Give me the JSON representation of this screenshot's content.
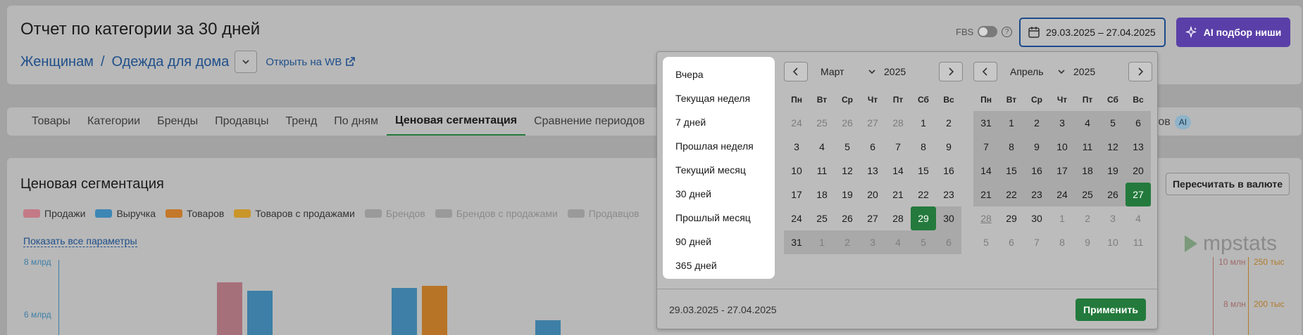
{
  "header": {
    "title": "Отчет по категории за 30 дней",
    "breadcrumb": [
      "Женщинам",
      "Одежда для дома"
    ],
    "open_wb": "Открыть на WB",
    "fbs_label": "FBS",
    "date_range": "29.03.2025 – 27.04.2025",
    "ai_button": "AI подбор ниши"
  },
  "tabs": [
    "Товары",
    "Категории",
    "Бренды",
    "Продавцы",
    "Тренд",
    "По дням",
    "Ценовая сегментация",
    "Сравнение периодов"
  ],
  "active_tab": "Ценовая сегментация",
  "tab_tail": "ктов",
  "tab_tail_badge": "AI",
  "section": {
    "title": "Ценовая сегментация",
    "recalc_button": "Пересчитать в валюте",
    "show_all": "Показать все параметры",
    "legend": [
      {
        "label": "Продажи",
        "color": "#c47a86",
        "active": true
      },
      {
        "label": "Выручка",
        "color": "#3d87b5",
        "active": true
      },
      {
        "label": "Товаров",
        "color": "#c4782a",
        "active": true
      },
      {
        "label": "Товаров с продажами",
        "color": "#c9962a",
        "active": true
      },
      {
        "label": "Брендов",
        "color": "#9a9a9a",
        "active": false
      },
      {
        "label": "Брендов с продажами",
        "color": "#9a9a9a",
        "active": false
      },
      {
        "label": "Продавцов",
        "color": "#9a9a9a",
        "active": false
      }
    ],
    "y_ticks": [
      "8 млрд",
      "6 млрд"
    ],
    "right_ticks_1": [
      "10 млн",
      "8 млн"
    ],
    "right_ticks_2": [
      "250 тыс",
      "200 тыс"
    ],
    "brand": "mpstats"
  },
  "picker": {
    "presets": [
      "Вчера",
      "Текущая неделя",
      "7 дней",
      "Прошлая неделя",
      "Текущий месяц",
      "30 дней",
      "Прошлый месяц",
      "90 дней",
      "365 дней"
    ],
    "weekdays": [
      "Пн",
      "Вт",
      "Ср",
      "Чт",
      "Пт",
      "Сб",
      "Вс"
    ],
    "left_month": "Март",
    "left_year": "2025",
    "right_month": "Апрель",
    "right_year": "2025",
    "left_days": [
      [
        "24",
        "25",
        "26",
        "27",
        "28",
        "1",
        "2"
      ],
      [
        "3",
        "4",
        "5",
        "6",
        "7",
        "8",
        "9"
      ],
      [
        "10",
        "11",
        "12",
        "13",
        "14",
        "15",
        "16"
      ],
      [
        "17",
        "18",
        "19",
        "20",
        "21",
        "22",
        "23"
      ],
      [
        "24",
        "25",
        "26",
        "27",
        "28",
        "29",
        "30"
      ],
      [
        "31",
        "1",
        "2",
        "3",
        "4",
        "5",
        "6"
      ]
    ],
    "right_days": [
      [
        "31",
        "1",
        "2",
        "3",
        "4",
        "5",
        "6"
      ],
      [
        "7",
        "8",
        "9",
        "10",
        "11",
        "12",
        "13"
      ],
      [
        "14",
        "15",
        "16",
        "17",
        "18",
        "19",
        "20"
      ],
      [
        "21",
        "22",
        "23",
        "24",
        "25",
        "26",
        "27"
      ],
      [
        "28",
        "29",
        "30",
        "1",
        "2",
        "3",
        "4"
      ],
      [
        "5",
        "6",
        "7",
        "8",
        "9",
        "10",
        "11"
      ]
    ],
    "range_text": "29.03.2025 - 27.04.2025",
    "apply_button": "Применить",
    "accent": "#237a3c"
  }
}
